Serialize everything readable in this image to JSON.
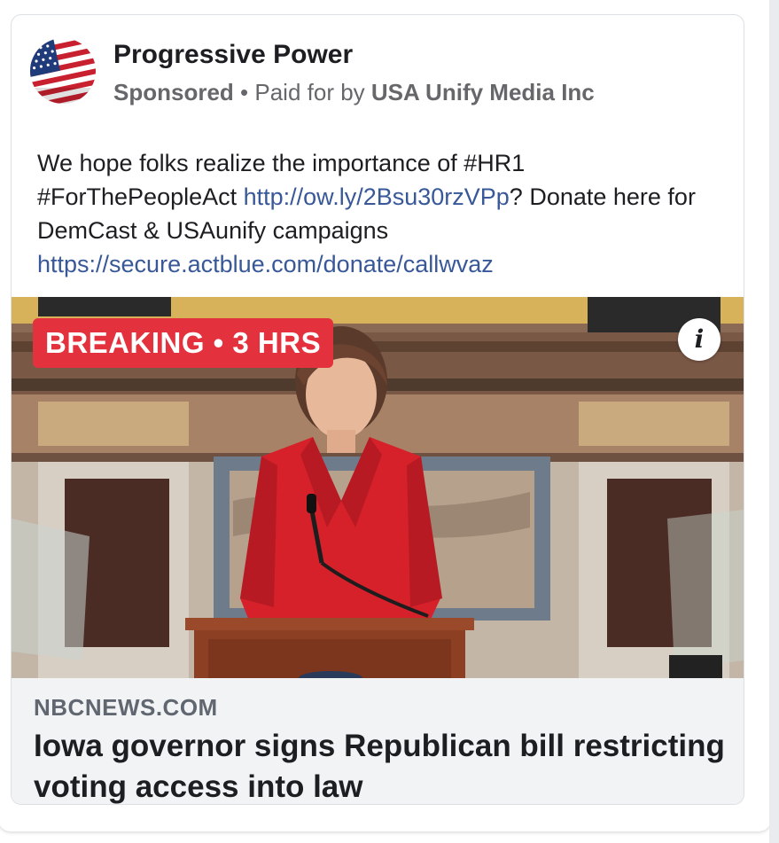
{
  "post": {
    "author": "Progressive Power",
    "sponsored_label": "Sponsored",
    "separator": "•",
    "paid_for_prefix": "Paid for by",
    "paid_for_name": "USA Unify Media Inc",
    "text_1": "We hope folks realize the importance of #HR1 #ForThePeopleAct ",
    "link_1": "http://ow.ly/2Bsu30rzVPp",
    "text_2": "? Donate here for DemCast & USAunify campaigns ",
    "link_2": "https://secure.actblue.com/donate/callwvaz"
  },
  "media": {
    "badge": "BREAKING • 3 HRS",
    "info_icon_glyph": "i",
    "icons": [
      "flag-avatar-icon",
      "info-icon"
    ]
  },
  "link_preview": {
    "domain": "NBCNEWS.COM",
    "headline": "Iowa governor signs Republican bill restricting voting access into law"
  },
  "colors": {
    "badge_red": "#e3323e",
    "link_blue": "#385898",
    "jacket_red": "#d6212b",
    "preview_bg": "#f2f3f5"
  }
}
